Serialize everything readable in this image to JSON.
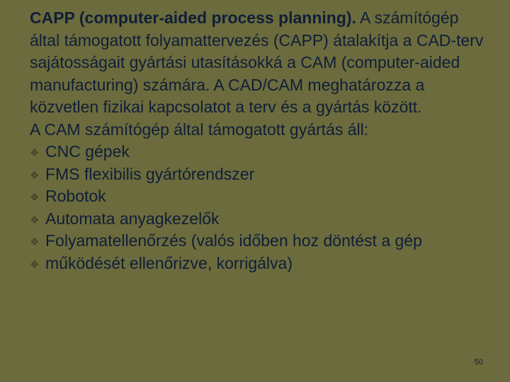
{
  "slide": {
    "paragraph1_prefix_term": "CAPP (computer-aided process planning).",
    "paragraph1_rest": " A számítógép által támogatott folyamattervezés (CAPP) átalakítja a CAD-terv sajátosságait gyártási utasításokká a CAM (computer-aided manufacturing) számára. A CAD/CAM meghatározza a közvetlen fizikai kapcsolatot a terv és a gyártás között.",
    "paragraph2": "A CAM számítógép által támogatott gyártás áll:",
    "bullets": [
      "CNC gépek",
      "FMS flexibilis gyártórendszer",
      "Robotok",
      "Automata anyagkezelők",
      "Folyamatellenőrzés (valós időben hoz döntést a gép",
      "működését ellenőrizve, korrigálva)"
    ],
    "page_number": "50"
  }
}
